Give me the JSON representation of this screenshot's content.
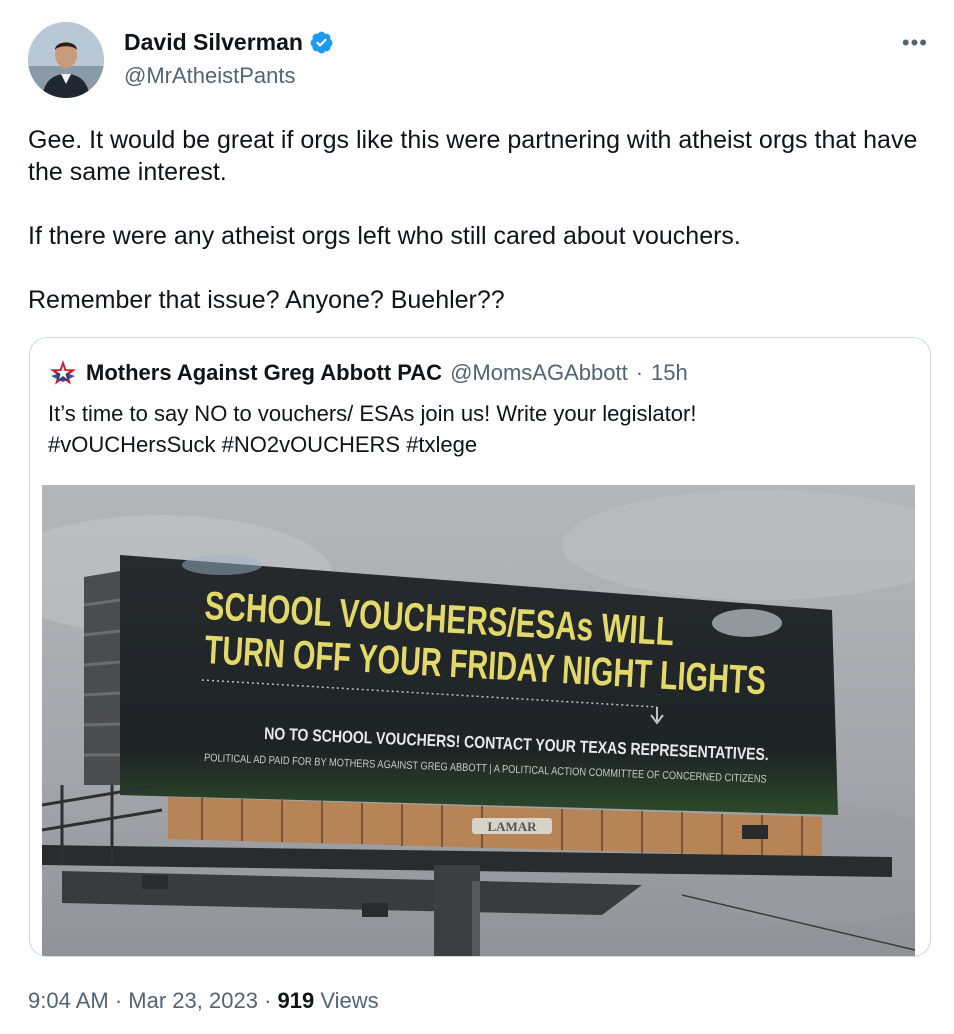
{
  "author": {
    "display_name": "David Silverman",
    "handle": "@MrAtheistPants",
    "verified": true,
    "verified_color": "#1d9bf0"
  },
  "tweet": {
    "paragraphs": [
      "Gee. It would be great if orgs like this were partnering with atheist orgs that have the same interest.",
      "If there were any atheist orgs left who still cared about vouchers.",
      "Remember that issue?  Anyone?  Buehler??"
    ]
  },
  "quoted_tweet": {
    "display_name": "Mothers Against Greg Abbott PAC",
    "handle": "@MomsAGAbbott",
    "separator": "·",
    "age": "15h",
    "text_line1": "It’s time to say NO to vouchers/ ESAs join us! Write your legislator!",
    "text_line2": "#vOUCHersSuck #NO2vOUCHERS #txlege",
    "billboard": {
      "headline_line1": "SCHOOL VOUCHERS/ESAs WILL",
      "headline_line2": "TURN OFF YOUR FRIDAY NIGHT LIGHTS",
      "subline": "NO TO SCHOOL VOUCHERS!  CONTACT YOUR TEXAS REPRESENTATIVES.",
      "disclaimer": "POLITICAL AD PAID FOR BY MOTHERS AGAINST GREG ABBOTT | A POLITICAL ACTION COMMITTEE OF CONCERNED CITIZENS",
      "vendor": "LAMAR"
    }
  },
  "meta": {
    "time": "9:04 AM",
    "separator": "·",
    "date": "Mar 23, 2023",
    "views_count": "919",
    "views_label": "Views"
  },
  "icons": {
    "more": "more-options-icon",
    "verified": "verified-badge-icon",
    "pac_logo": "star-logo-icon"
  },
  "colors": {
    "text_primary": "#0f1419",
    "text_secondary": "#536471",
    "border": "#cfd9de",
    "billboard_text": "#e3d96a"
  }
}
